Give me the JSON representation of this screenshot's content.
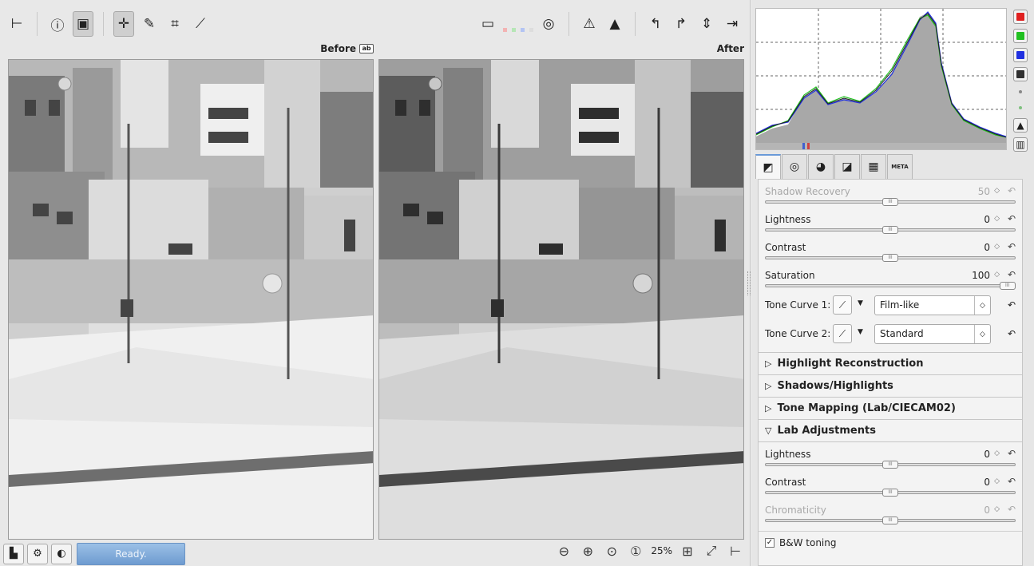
{
  "labels": {
    "before": "Before",
    "after": "After",
    "before_badge": "ab"
  },
  "statusbar": {
    "status": "Ready.",
    "zoom": "25%"
  },
  "histogram": {
    "channels": [
      {
        "name": "red",
        "color": "#e02020"
      },
      {
        "name": "green",
        "color": "#20c020"
      },
      {
        "name": "blue",
        "color": "#2030e0"
      },
      {
        "name": "luminance",
        "color": "#303030"
      }
    ]
  },
  "tabs": [
    {
      "name": "exposure"
    },
    {
      "name": "detail"
    },
    {
      "name": "color"
    },
    {
      "name": "transform"
    },
    {
      "name": "raw"
    },
    {
      "name": "metadata",
      "label": "META"
    }
  ],
  "exposure": {
    "shadow_recovery": {
      "label": "Shadow Recovery",
      "value": "50",
      "fraction": 0.5
    },
    "lightness": {
      "label": "Lightness",
      "value": "0",
      "fraction": 0.5
    },
    "contrast": {
      "label": "Contrast",
      "value": "0",
      "fraction": 0.5
    },
    "saturation": {
      "label": "Saturation",
      "value": "100",
      "fraction": 1.0
    },
    "tone_curve_1": {
      "label": "Tone Curve 1:",
      "mode": "Film-like"
    },
    "tone_curve_2": {
      "label": "Tone Curve 2:",
      "mode": "Standard"
    }
  },
  "sections": {
    "highlight": "Highlight Reconstruction",
    "shadows": "Shadows/Highlights",
    "tone_mapping": "Tone Mapping (Lab/CIECAM02)",
    "lab": "Lab Adjustments"
  },
  "lab": {
    "lightness": {
      "label": "Lightness",
      "value": "0",
      "fraction": 0.5
    },
    "contrast": {
      "label": "Contrast",
      "value": "0",
      "fraction": 0.5
    },
    "chromaticity": {
      "label": "Chromaticity",
      "value": "0",
      "fraction": 0.5
    },
    "bw_toning": {
      "label": "B&W toning",
      "checked": true
    }
  },
  "colors": {
    "accent": "#6a9ad8",
    "progress": "#7ea7d8"
  }
}
